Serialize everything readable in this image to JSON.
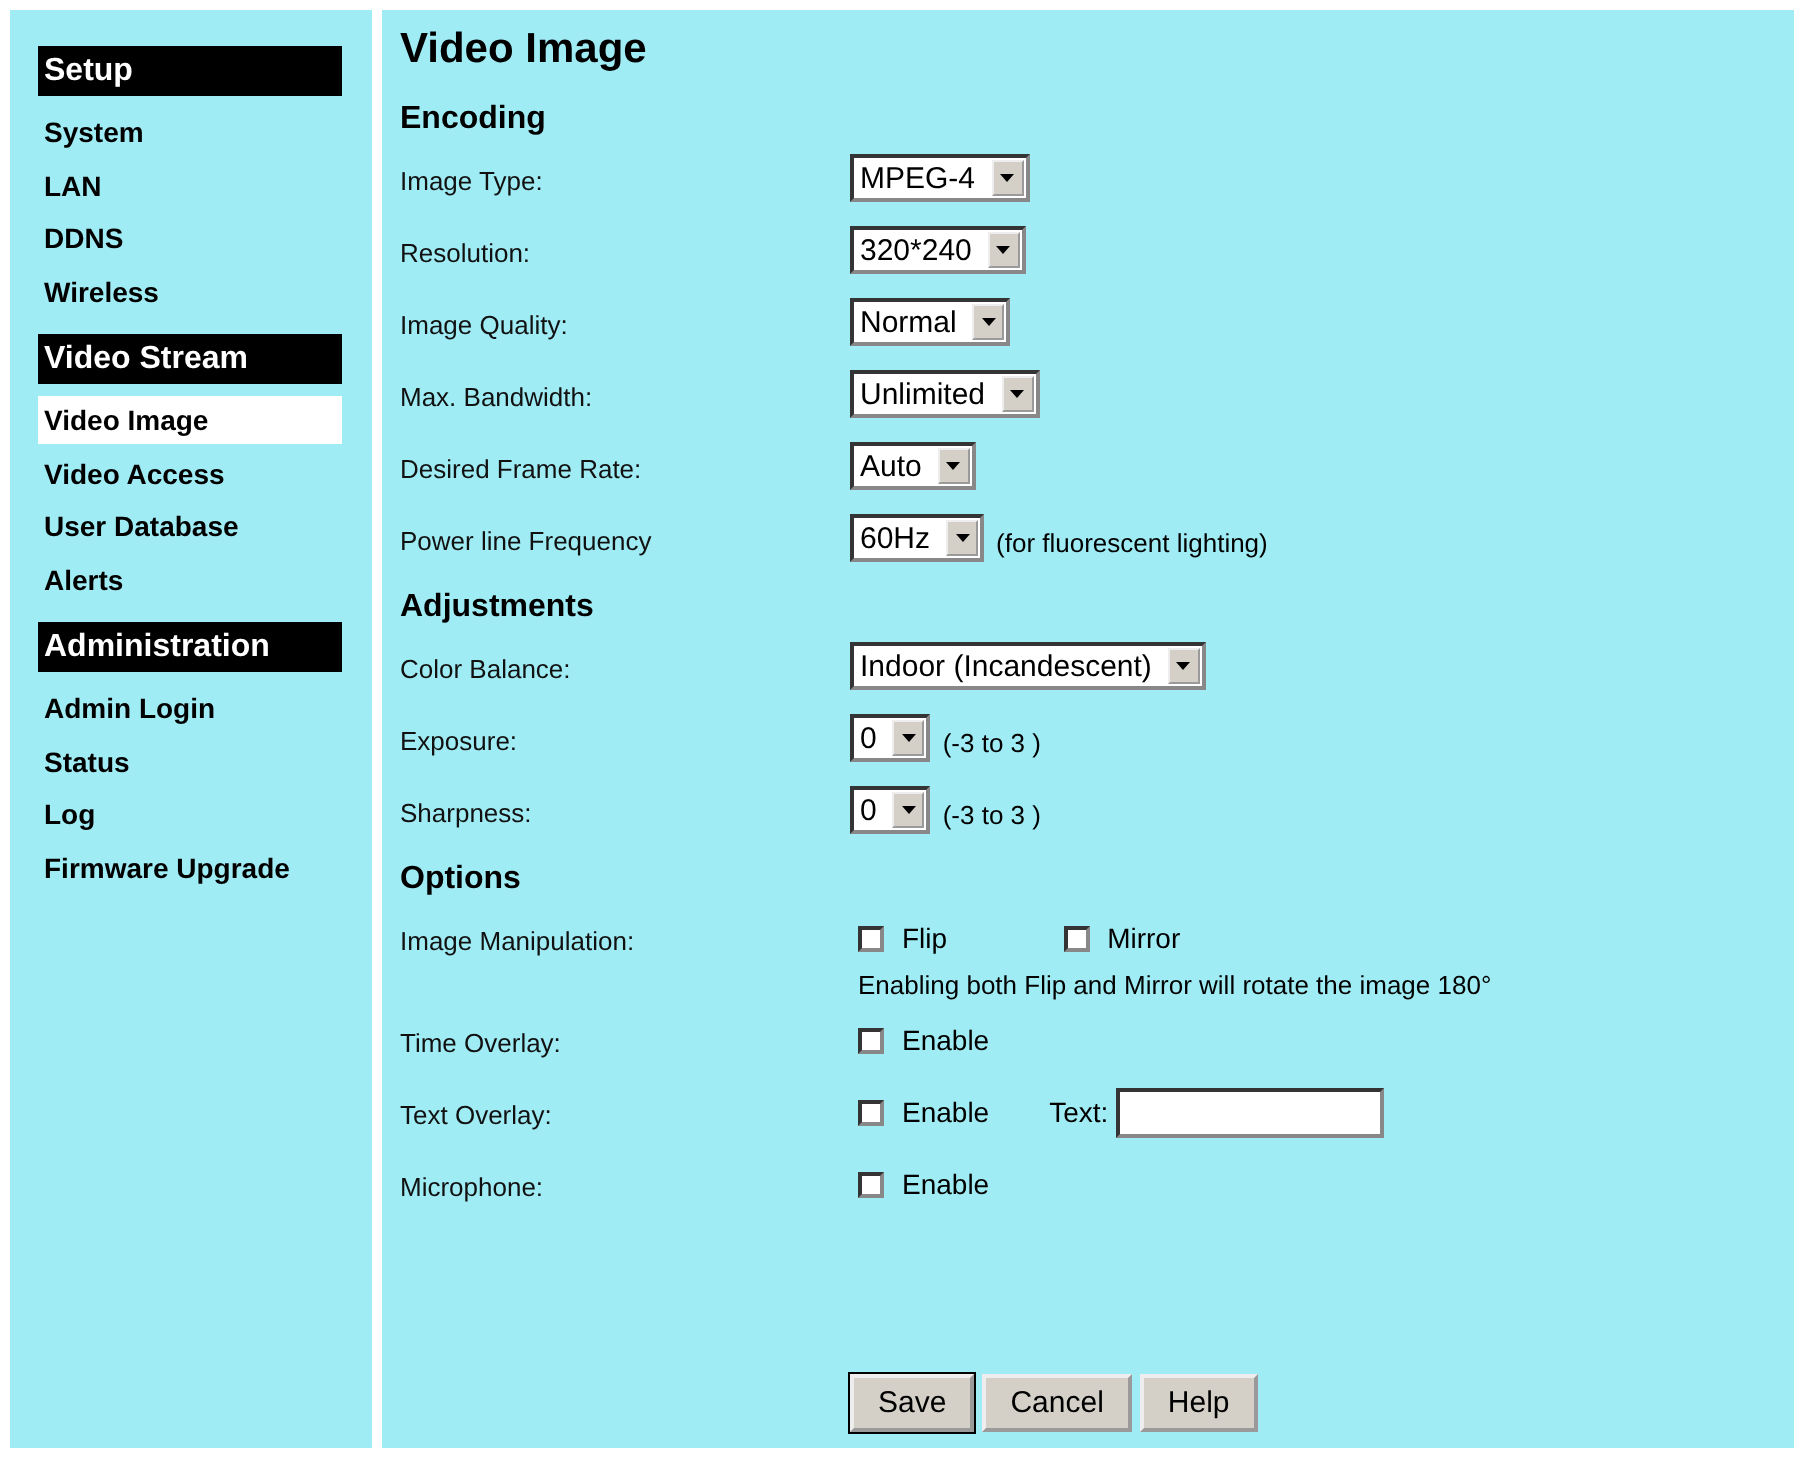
{
  "sidebar": {
    "sections": [
      {
        "title": "Setup",
        "items": [
          {
            "label": "System",
            "selected": false
          },
          {
            "label": "LAN",
            "selected": false
          },
          {
            "label": "DDNS",
            "selected": false
          },
          {
            "label": "Wireless",
            "selected": false
          }
        ]
      },
      {
        "title": "Video Stream",
        "items": [
          {
            "label": "Video Image",
            "selected": true
          },
          {
            "label": "Video Access",
            "selected": false
          },
          {
            "label": "User Database",
            "selected": false
          },
          {
            "label": "Alerts",
            "selected": false
          }
        ]
      },
      {
        "title": "Administration",
        "items": [
          {
            "label": "Admin Login",
            "selected": false
          },
          {
            "label": "Status",
            "selected": false
          },
          {
            "label": "Log",
            "selected": false
          },
          {
            "label": "Firmware Upgrade",
            "selected": false
          }
        ]
      }
    ]
  },
  "main": {
    "title": "Video Image",
    "sections": [
      {
        "heading": "Encoding",
        "rows": [
          {
            "label": "Image Type:",
            "controls": [
              {
                "kind": "select",
                "value": "MPEG-4"
              }
            ]
          },
          {
            "label": "Resolution:",
            "controls": [
              {
                "kind": "select",
                "value": "320*240"
              }
            ]
          },
          {
            "label": "Image Quality:",
            "controls": [
              {
                "kind": "select",
                "value": "Normal"
              }
            ]
          },
          {
            "label": "Max. Bandwidth:",
            "controls": [
              {
                "kind": "select",
                "value": "Unlimited"
              }
            ]
          },
          {
            "label": "Desired Frame Rate:",
            "controls": [
              {
                "kind": "select",
                "value": "Auto"
              }
            ]
          },
          {
            "label": "Power line Frequency",
            "controls": [
              {
                "kind": "select",
                "value": "60Hz"
              },
              {
                "kind": "note",
                "text": "(for fluorescent lighting)"
              }
            ]
          }
        ]
      },
      {
        "heading": "Adjustments",
        "rows": [
          {
            "label": "Color Balance:",
            "controls": [
              {
                "kind": "select",
                "value": "Indoor (Incandescent)"
              }
            ]
          },
          {
            "label": "Exposure:",
            "controls": [
              {
                "kind": "select",
                "value": "0"
              },
              {
                "kind": "note",
                "text": "(-3 to 3 )"
              }
            ]
          },
          {
            "label": "Sharpness:",
            "controls": [
              {
                "kind": "select",
                "value": "0"
              },
              {
                "kind": "note",
                "text": "(-3 to 3 )"
              }
            ]
          }
        ]
      },
      {
        "heading": "Options",
        "rows": [
          {
            "label": "Image Manipulation:",
            "controls": [
              {
                "kind": "checkbox",
                "label": "Flip",
                "checked": false
              },
              {
                "kind": "checkbox",
                "label": "Mirror",
                "checked": false
              }
            ],
            "hint": "Enabling both Flip and Mirror will rotate the image 180°"
          },
          {
            "label": "Time Overlay:",
            "controls": [
              {
                "kind": "checkbox",
                "label": "Enable",
                "checked": false
              }
            ]
          },
          {
            "label": "Text Overlay:",
            "controls": [
              {
                "kind": "checkbox",
                "label": "Enable",
                "checked": false
              },
              {
                "kind": "field",
                "label": "Text:"
              }
            ]
          },
          {
            "label": "Microphone:",
            "controls": [
              {
                "kind": "checkbox",
                "label": "Enable",
                "checked": false
              }
            ]
          }
        ]
      }
    ],
    "buttons": [
      {
        "label": "Save",
        "default": true
      },
      {
        "label": "Cancel",
        "default": false
      },
      {
        "label": "Help",
        "default": false
      }
    ]
  }
}
